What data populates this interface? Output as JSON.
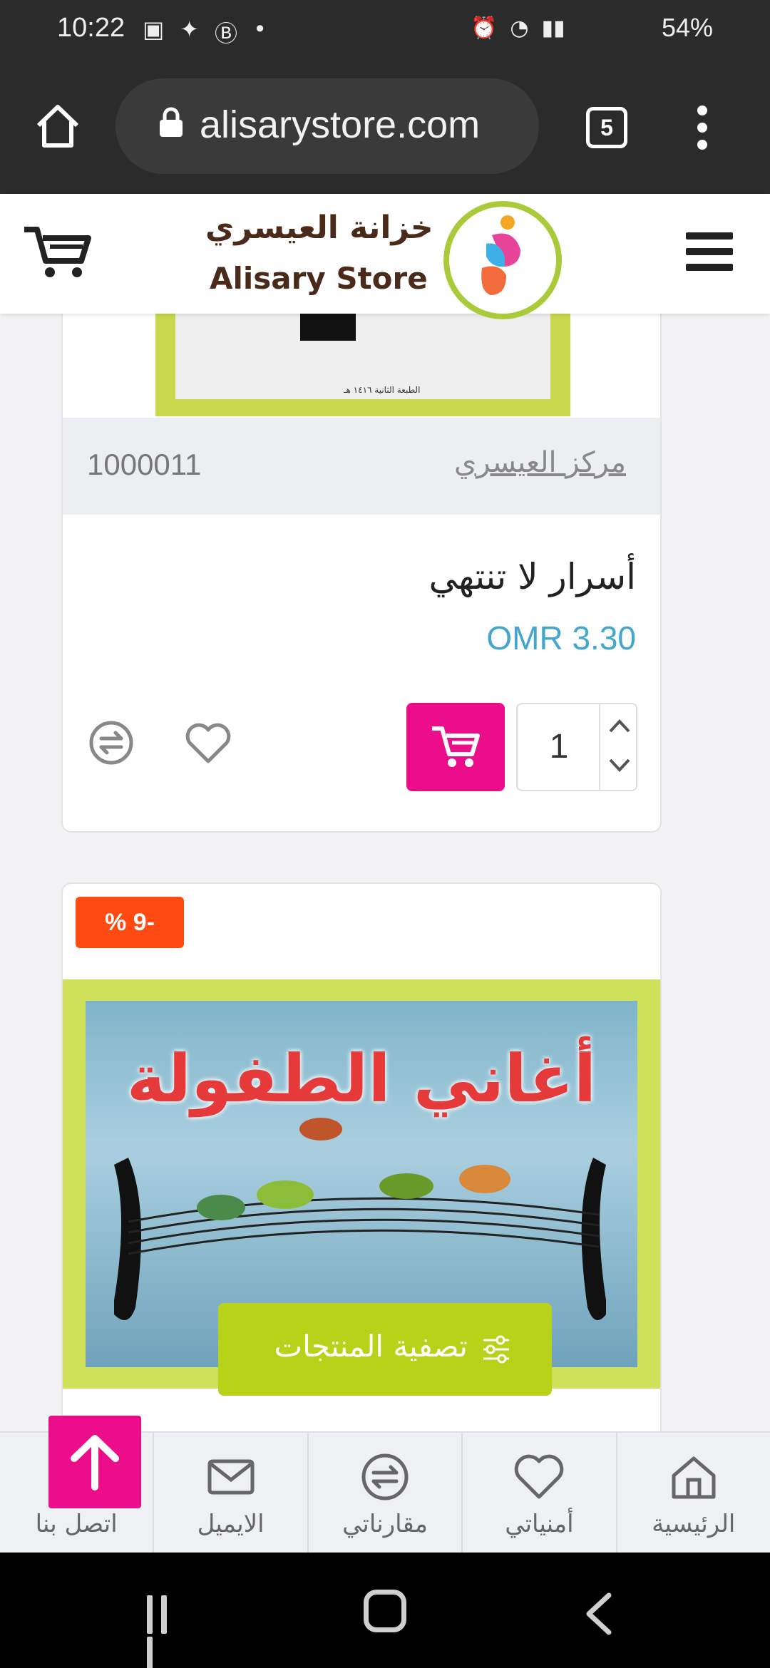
{
  "status_bar": {
    "time": "10:22",
    "battery": "54%"
  },
  "browser": {
    "url": "alisarystore.com",
    "tab_count": "5"
  },
  "site_header": {
    "brand_ar": "خزانة العيسري",
    "brand_en": "Alisary Store"
  },
  "product1": {
    "sku": "1000011",
    "brand": "مركز العيسري",
    "title": "أسرار لا تنتهي",
    "price": "OMR 3.30",
    "quantity": "1",
    "cover_caption": "الطبعة الثانية ١٤١٦ هـ"
  },
  "product2": {
    "discount": "-9 %",
    "cover_title": "أغاني الطفولة"
  },
  "filter_button": {
    "label": "تصفية المنتجات"
  },
  "bottom_nav": {
    "items": [
      {
        "label": "اتصل بنا",
        "icon": "phone-icon"
      },
      {
        "label": "الايميل",
        "icon": "envelope-icon"
      },
      {
        "label": "مقارناتي",
        "icon": "compare-icon"
      },
      {
        "label": "أمنياتي",
        "icon": "heart-icon"
      },
      {
        "label": "الرئيسية",
        "icon": "home-icon"
      }
    ]
  },
  "colors": {
    "accent_pink": "#ec0d8a",
    "accent_green": "#b8d21a",
    "price_blue": "#45a6cc",
    "discount_orange": "#ff4a12"
  }
}
